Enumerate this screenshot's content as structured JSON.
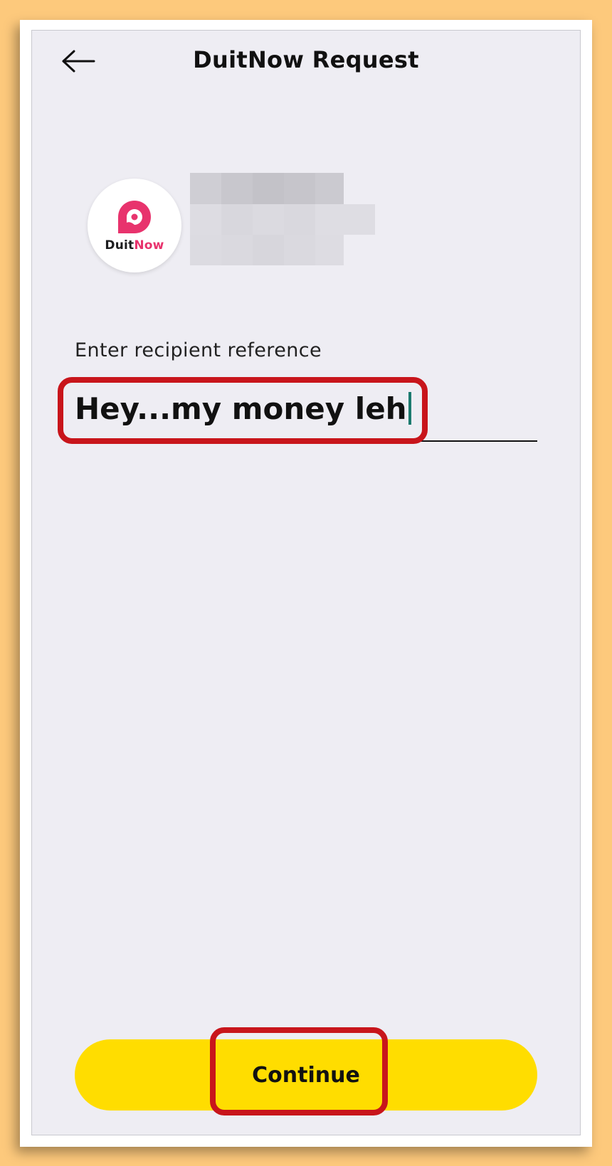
{
  "header": {
    "title": "DuitNow Request",
    "back_icon": "arrow-left-icon"
  },
  "recipient": {
    "avatar_icon": "duitnow-logo-icon",
    "logo_text_duit": "Duit",
    "logo_text_now": "Now",
    "name_redacted": true
  },
  "reference_field": {
    "label": "Enter recipient reference",
    "value": "Hey...my money leh"
  },
  "footer": {
    "continue_label": "Continue"
  },
  "colors": {
    "background": "#eeedf3",
    "primary_button": "#ffdd00",
    "brand_pink": "#e8336d",
    "caret": "#1b7a6e",
    "annotation_red": "#c8151b"
  }
}
